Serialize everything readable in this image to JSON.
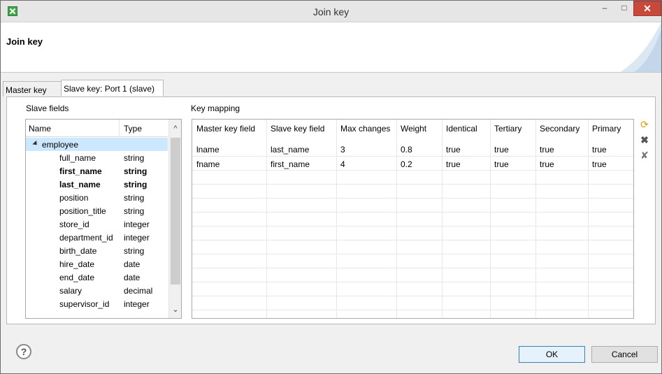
{
  "window": {
    "title": "Join key"
  },
  "header": {
    "title": "Join key"
  },
  "tabs": [
    {
      "label": "Master key"
    },
    {
      "label": "Slave key: Port 1 (slave)"
    }
  ],
  "slave_fields": {
    "label": "Slave fields",
    "columns": [
      "Name",
      "Type"
    ],
    "root": "employee",
    "rows": [
      {
        "name": "full_name",
        "type": "string"
      },
      {
        "name": "first_name",
        "type": "string"
      },
      {
        "name": "last_name",
        "type": "string"
      },
      {
        "name": "position",
        "type": "string"
      },
      {
        "name": "position_title",
        "type": "string"
      },
      {
        "name": "store_id",
        "type": "integer"
      },
      {
        "name": "department_id",
        "type": "integer"
      },
      {
        "name": "birth_date",
        "type": "string"
      },
      {
        "name": "hire_date",
        "type": "date"
      },
      {
        "name": "end_date",
        "type": "date"
      },
      {
        "name": "salary",
        "type": "decimal"
      },
      {
        "name": "supervisor_id",
        "type": "integer"
      }
    ]
  },
  "key_mapping": {
    "label": "Key mapping",
    "columns": [
      "Master key field",
      "Slave key field",
      "Max changes",
      "Weight",
      "Identical",
      "Tertiary",
      "Secondary",
      "Primary"
    ],
    "rows": [
      [
        "lname",
        "last_name",
        "3",
        "0.8",
        "true",
        "true",
        "true",
        "true"
      ],
      [
        "fname",
        "first_name",
        "4",
        "0.2",
        "true",
        "true",
        "true",
        "true"
      ]
    ]
  },
  "buttons": {
    "ok": "OK",
    "cancel": "Cancel",
    "help": "?"
  },
  "icons": {
    "add": "add-mapping-icon",
    "delete": "delete-icon",
    "clear": "clear-all-icon"
  }
}
